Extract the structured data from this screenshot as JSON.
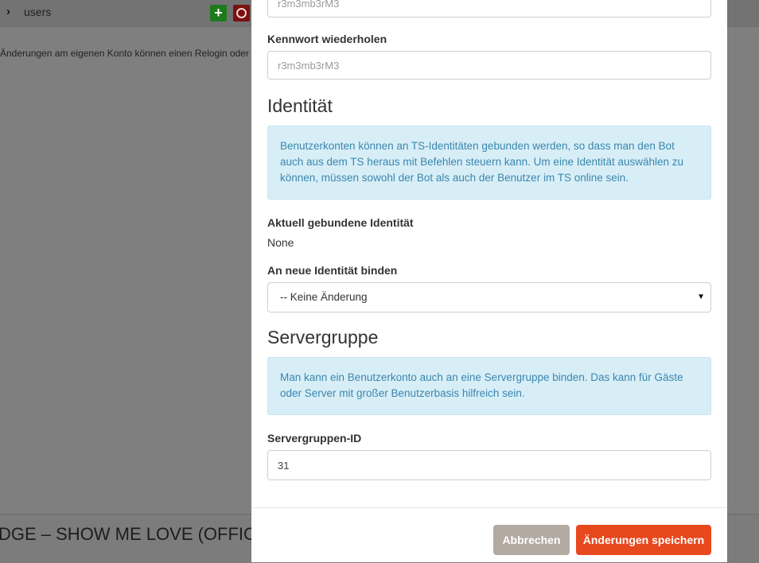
{
  "background": {
    "tree_item": "users",
    "note": "Änderungen am eigenen Konto können einen Relogin oder",
    "player_title": "DGE – SHOW ME LOVE (OFFICIA"
  },
  "modal": {
    "password_value": "r3m3mb3rM3",
    "repeat_password_label": "Kennwort wiederholen",
    "repeat_password_value": "r3m3mb3rM3",
    "identity_title": "Identität",
    "identity_info": "Benutzerkonten können an TS-Identitäten gebunden werden, so dass man den Bot auch aus dem TS heraus mit Befehlen steuern kann. Um eine Identität auswählen zu können, müssen sowohl der Bot als auch der Benutzer im TS online sein.",
    "current_identity_label": "Aktuell gebundene Identität",
    "current_identity_value": "None",
    "bind_identity_label": "An neue Identität binden",
    "bind_identity_selected": "-- Keine Änderung",
    "servergroup_title": "Servergruppe",
    "servergroup_info": "Man kann ein Benutzerkonto auch an eine Servergruppe binden. Das kann für Gäste oder Server mit großer Benutzerbasis hilfreich sein.",
    "servergroup_id_label": "Servergruppen-ID",
    "servergroup_id_value": "31",
    "cancel_label": "Abbrechen",
    "save_label": "Änderungen speichern"
  },
  "colors": {
    "save_button": "#e8481d",
    "cancel_button": "#b3aaa2",
    "info_background": "#d8eef7",
    "info_text": "#3a87ad"
  }
}
